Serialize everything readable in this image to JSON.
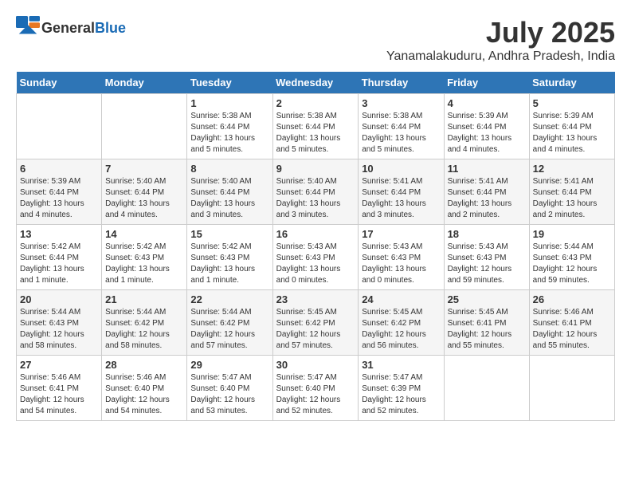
{
  "header": {
    "logo_general": "General",
    "logo_blue": "Blue",
    "month": "July 2025",
    "location": "Yanamalakuduru, Andhra Pradesh, India"
  },
  "weekdays": [
    "Sunday",
    "Monday",
    "Tuesday",
    "Wednesday",
    "Thursday",
    "Friday",
    "Saturday"
  ],
  "weeks": [
    [
      {
        "day": "",
        "info": ""
      },
      {
        "day": "",
        "info": ""
      },
      {
        "day": "1",
        "info": "Sunrise: 5:38 AM\nSunset: 6:44 PM\nDaylight: 13 hours and 5 minutes."
      },
      {
        "day": "2",
        "info": "Sunrise: 5:38 AM\nSunset: 6:44 PM\nDaylight: 13 hours and 5 minutes."
      },
      {
        "day": "3",
        "info": "Sunrise: 5:38 AM\nSunset: 6:44 PM\nDaylight: 13 hours and 5 minutes."
      },
      {
        "day": "4",
        "info": "Sunrise: 5:39 AM\nSunset: 6:44 PM\nDaylight: 13 hours and 4 minutes."
      },
      {
        "day": "5",
        "info": "Sunrise: 5:39 AM\nSunset: 6:44 PM\nDaylight: 13 hours and 4 minutes."
      }
    ],
    [
      {
        "day": "6",
        "info": "Sunrise: 5:39 AM\nSunset: 6:44 PM\nDaylight: 13 hours and 4 minutes."
      },
      {
        "day": "7",
        "info": "Sunrise: 5:40 AM\nSunset: 6:44 PM\nDaylight: 13 hours and 4 minutes."
      },
      {
        "day": "8",
        "info": "Sunrise: 5:40 AM\nSunset: 6:44 PM\nDaylight: 13 hours and 3 minutes."
      },
      {
        "day": "9",
        "info": "Sunrise: 5:40 AM\nSunset: 6:44 PM\nDaylight: 13 hours and 3 minutes."
      },
      {
        "day": "10",
        "info": "Sunrise: 5:41 AM\nSunset: 6:44 PM\nDaylight: 13 hours and 3 minutes."
      },
      {
        "day": "11",
        "info": "Sunrise: 5:41 AM\nSunset: 6:44 PM\nDaylight: 13 hours and 2 minutes."
      },
      {
        "day": "12",
        "info": "Sunrise: 5:41 AM\nSunset: 6:44 PM\nDaylight: 13 hours and 2 minutes."
      }
    ],
    [
      {
        "day": "13",
        "info": "Sunrise: 5:42 AM\nSunset: 6:44 PM\nDaylight: 13 hours and 1 minute."
      },
      {
        "day": "14",
        "info": "Sunrise: 5:42 AM\nSunset: 6:43 PM\nDaylight: 13 hours and 1 minute."
      },
      {
        "day": "15",
        "info": "Sunrise: 5:42 AM\nSunset: 6:43 PM\nDaylight: 13 hours and 1 minute."
      },
      {
        "day": "16",
        "info": "Sunrise: 5:43 AM\nSunset: 6:43 PM\nDaylight: 13 hours and 0 minutes."
      },
      {
        "day": "17",
        "info": "Sunrise: 5:43 AM\nSunset: 6:43 PM\nDaylight: 13 hours and 0 minutes."
      },
      {
        "day": "18",
        "info": "Sunrise: 5:43 AM\nSunset: 6:43 PM\nDaylight: 12 hours and 59 minutes."
      },
      {
        "day": "19",
        "info": "Sunrise: 5:44 AM\nSunset: 6:43 PM\nDaylight: 12 hours and 59 minutes."
      }
    ],
    [
      {
        "day": "20",
        "info": "Sunrise: 5:44 AM\nSunset: 6:43 PM\nDaylight: 12 hours and 58 minutes."
      },
      {
        "day": "21",
        "info": "Sunrise: 5:44 AM\nSunset: 6:42 PM\nDaylight: 12 hours and 58 minutes."
      },
      {
        "day": "22",
        "info": "Sunrise: 5:44 AM\nSunset: 6:42 PM\nDaylight: 12 hours and 57 minutes."
      },
      {
        "day": "23",
        "info": "Sunrise: 5:45 AM\nSunset: 6:42 PM\nDaylight: 12 hours and 57 minutes."
      },
      {
        "day": "24",
        "info": "Sunrise: 5:45 AM\nSunset: 6:42 PM\nDaylight: 12 hours and 56 minutes."
      },
      {
        "day": "25",
        "info": "Sunrise: 5:45 AM\nSunset: 6:41 PM\nDaylight: 12 hours and 55 minutes."
      },
      {
        "day": "26",
        "info": "Sunrise: 5:46 AM\nSunset: 6:41 PM\nDaylight: 12 hours and 55 minutes."
      }
    ],
    [
      {
        "day": "27",
        "info": "Sunrise: 5:46 AM\nSunset: 6:41 PM\nDaylight: 12 hours and 54 minutes."
      },
      {
        "day": "28",
        "info": "Sunrise: 5:46 AM\nSunset: 6:40 PM\nDaylight: 12 hours and 54 minutes."
      },
      {
        "day": "29",
        "info": "Sunrise: 5:47 AM\nSunset: 6:40 PM\nDaylight: 12 hours and 53 minutes."
      },
      {
        "day": "30",
        "info": "Sunrise: 5:47 AM\nSunset: 6:40 PM\nDaylight: 12 hours and 52 minutes."
      },
      {
        "day": "31",
        "info": "Sunrise: 5:47 AM\nSunset: 6:39 PM\nDaylight: 12 hours and 52 minutes."
      },
      {
        "day": "",
        "info": ""
      },
      {
        "day": "",
        "info": ""
      }
    ]
  ]
}
